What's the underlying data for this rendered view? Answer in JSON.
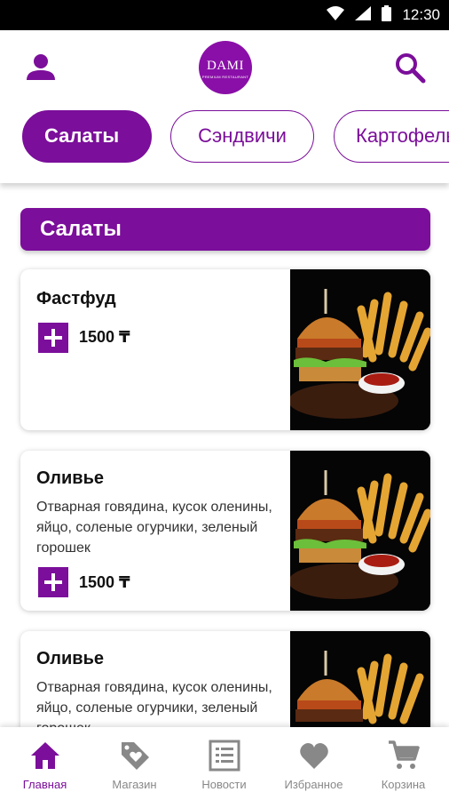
{
  "status_bar": {
    "time": "12:30",
    "icons": [
      "wifi-icon",
      "signal-icon",
      "battery-icon"
    ]
  },
  "header": {
    "logo_text": "DAMI",
    "logo_subtitle": "PREMIUM RESTAURANT",
    "icons": [
      "profile-icon",
      "search-icon"
    ]
  },
  "categories": {
    "tabs": [
      {
        "label": "Салаты",
        "active": true
      },
      {
        "label": "Сэндвичи",
        "active": false
      },
      {
        "label": "Картофель",
        "active": false
      }
    ]
  },
  "section": {
    "title": "Салаты"
  },
  "products": [
    {
      "title": "Фастфуд",
      "description": "",
      "price": "1500 ₸"
    },
    {
      "title": "Оливье",
      "description": "Отварная говядина, кусок оленины, яйцо, соленые огурчики, зеленый горошек",
      "price": "1500 ₸"
    },
    {
      "title": "Оливье",
      "description": "Отварная говядина, кусок оленины, яйцо, соленые огурчики, зеленый горошек",
      "price": ""
    }
  ],
  "bottom_nav": {
    "items": [
      {
        "label": "Главная",
        "icon": "home-icon",
        "active": true
      },
      {
        "label": "Магазин",
        "icon": "tag-heart-icon",
        "active": false
      },
      {
        "label": "Новости",
        "icon": "list-icon",
        "active": false
      },
      {
        "label": "Избранное",
        "icon": "heart-icon",
        "active": false
      },
      {
        "label": "Корзина",
        "icon": "cart-icon",
        "active": false
      }
    ]
  },
  "colors": {
    "accent": "#7b0e9a",
    "logo_bg": "#8a0fa8",
    "inactive_nav": "#888888"
  }
}
